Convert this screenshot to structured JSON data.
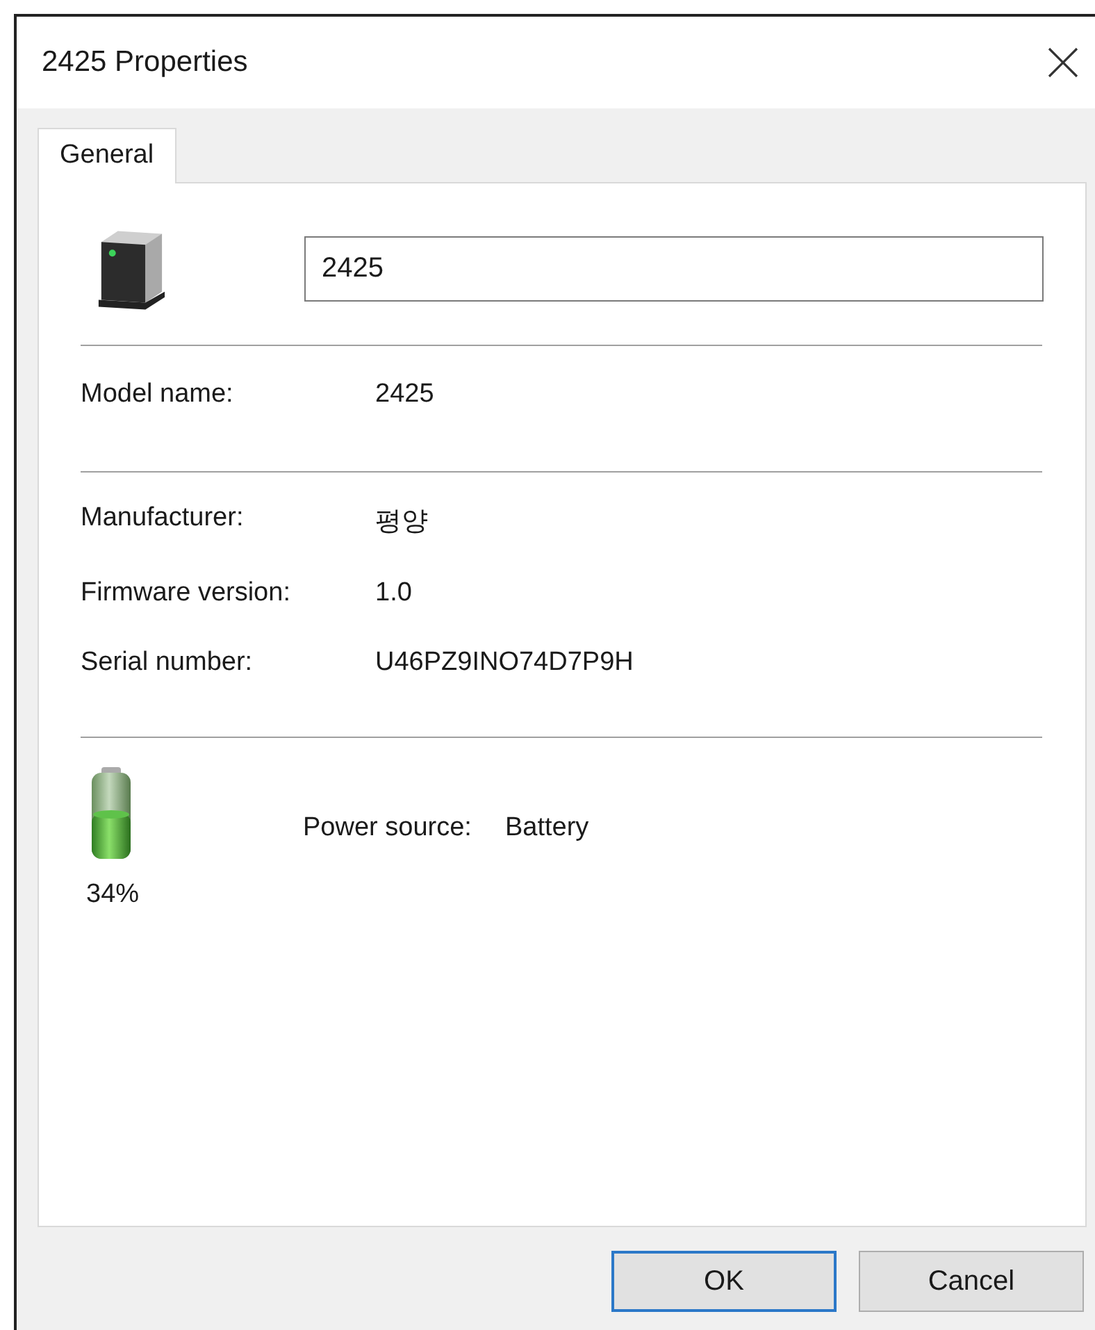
{
  "window": {
    "title": "2425 Properties"
  },
  "tabs": [
    {
      "label": "General",
      "selected": true
    }
  ],
  "device": {
    "name": "2425"
  },
  "detail_sections": [
    {
      "fields": [
        {
          "label": "Model name:",
          "value": "2425"
        }
      ]
    },
    {
      "fields": [
        {
          "label": "Manufacturer:",
          "value": "평양"
        },
        {
          "label": "Firmware version:",
          "value": "1.0"
        },
        {
          "label": "Serial number:",
          "value": "U46PZ9INO74D7P9H"
        }
      ]
    }
  ],
  "power": {
    "percent": "34%",
    "label": "Power source:",
    "value": "Battery"
  },
  "buttons": [
    {
      "label": "OK",
      "default": true
    },
    {
      "label": "Cancel",
      "default": false
    }
  ]
}
